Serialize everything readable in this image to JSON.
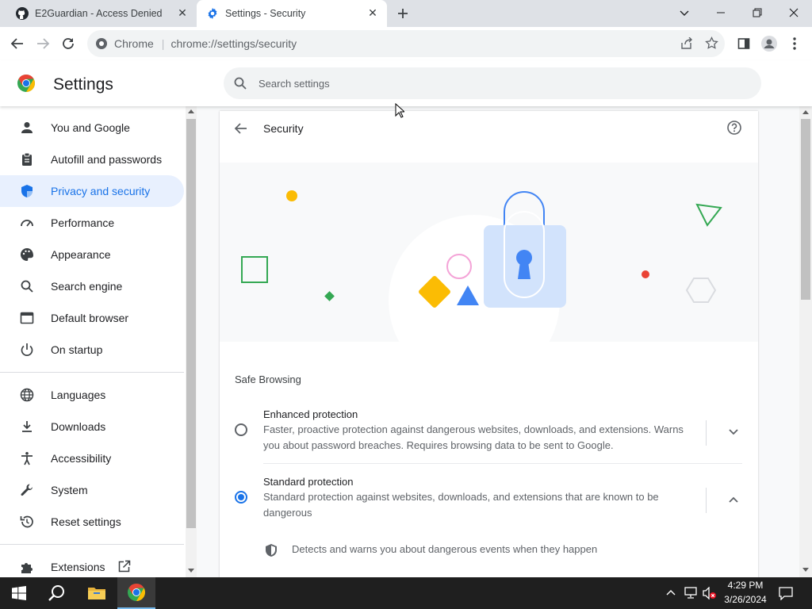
{
  "tabs": [
    {
      "title": "E2Guardian - Access Denied",
      "close": "✕"
    },
    {
      "title": "Settings - Security",
      "close": "✕"
    }
  ],
  "omnibox": {
    "site": "Chrome",
    "separator": "|",
    "url": "chrome://settings/security"
  },
  "settings": {
    "title": "Settings",
    "search_placeholder": "Search settings"
  },
  "sidebar": {
    "items": [
      {
        "label": "You and Google",
        "icon": "person-icon"
      },
      {
        "label": "Autofill and passwords",
        "icon": "clipboard-icon"
      },
      {
        "label": "Privacy and security",
        "icon": "shield-icon",
        "active": true
      },
      {
        "label": "Performance",
        "icon": "speedometer-icon"
      },
      {
        "label": "Appearance",
        "icon": "palette-icon"
      },
      {
        "label": "Search engine",
        "icon": "search-icon"
      },
      {
        "label": "Default browser",
        "icon": "browser-icon"
      },
      {
        "label": "On startup",
        "icon": "power-icon"
      }
    ],
    "items2": [
      {
        "label": "Languages",
        "icon": "globe-icon"
      },
      {
        "label": "Downloads",
        "icon": "download-icon"
      },
      {
        "label": "Accessibility",
        "icon": "accessibility-icon"
      },
      {
        "label": "System",
        "icon": "wrench-icon"
      },
      {
        "label": "Reset settings",
        "icon": "reset-icon"
      }
    ],
    "extensions": {
      "label": "Extensions",
      "icon": "puzzle-icon"
    }
  },
  "page": {
    "title": "Security",
    "section": "Safe Browsing",
    "options": [
      {
        "title": "Enhanced protection",
        "desc1": "Faster, proactive protection against dangerous websites, downloads, and extensions. Warns",
        "desc2": "you about password breaches. Requires browsing data to be sent to Google.",
        "selected": false
      },
      {
        "title": "Standard protection",
        "desc1": "Standard protection against websites, downloads, and extensions that are known to be",
        "desc2": "dangerous",
        "selected": true
      }
    ],
    "detail": "Detects and warns you about dangerous events when they happen"
  },
  "taskbar": {
    "time": "4:29 PM",
    "date": "3/26/2024"
  },
  "colors": {
    "accent": "#1a73e8",
    "active_bg": "#e8f0fe",
    "taskbar": "#1f1f1f"
  }
}
